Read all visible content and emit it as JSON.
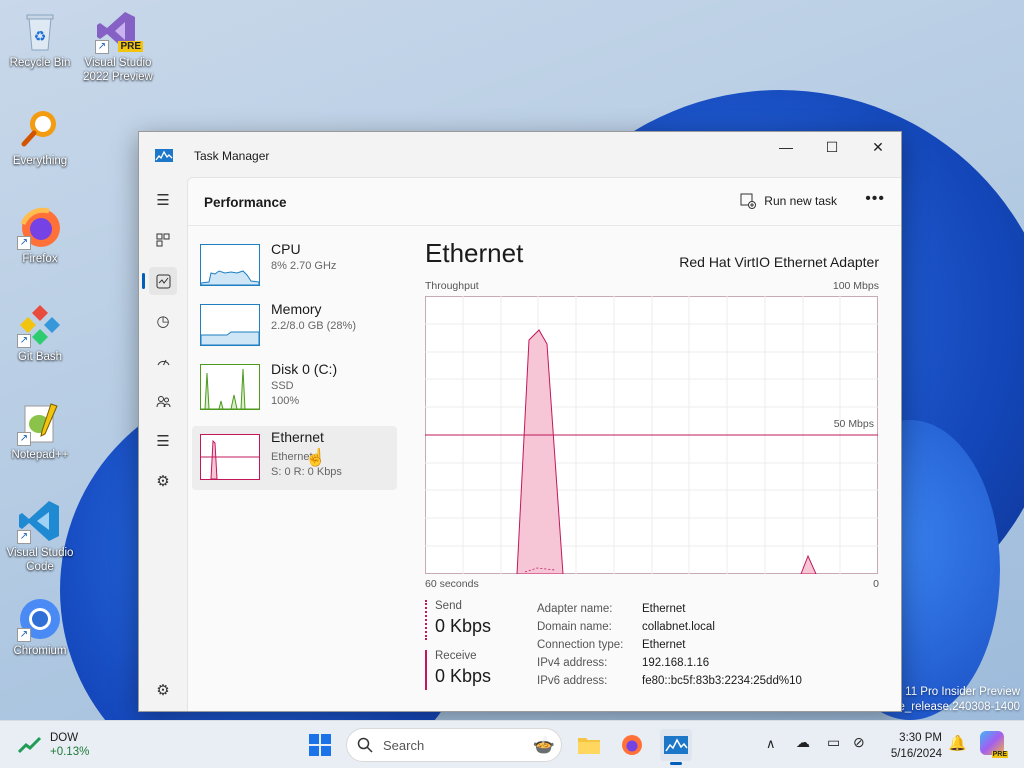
{
  "desktop": {
    "icons": [
      {
        "label": "Recycle Bin",
        "icon": "recycle-bin-icon"
      },
      {
        "label": "Visual Studio 2022 Preview",
        "icon": "visual-studio-preview-icon",
        "badge": "PRE"
      },
      {
        "label": "Everything",
        "icon": "everything-search-icon"
      },
      {
        "label": "Firefox",
        "icon": "firefox-icon"
      },
      {
        "label": "Git Bash",
        "icon": "git-bash-icon"
      },
      {
        "label": "Notepad++",
        "icon": "notepad-plus-plus-icon"
      },
      {
        "label": "Visual Studio Code",
        "icon": "vscode-icon"
      },
      {
        "label": "Chromium",
        "icon": "chromium-icon"
      }
    ],
    "watermark_line1": "11 Pro Insider Preview",
    "watermark_line2": "e_release.240308-1400"
  },
  "window": {
    "title": "Task Manager",
    "page_title": "Performance",
    "run_new_task": "Run new task",
    "more": "•••"
  },
  "perf_list": [
    {
      "name": "CPU",
      "sub1": "8%  2.70 GHz",
      "sub2": ""
    },
    {
      "name": "Memory",
      "sub1": "2.2/8.0 GB (28%)",
      "sub2": ""
    },
    {
      "name": "Disk 0 (C:)",
      "sub1": "SSD",
      "sub2": "100%"
    },
    {
      "name": "Ethernet",
      "sub1": "Ethernet",
      "sub2": "S: 0  R: 0 Kbps"
    }
  ],
  "detail": {
    "title": "Ethernet",
    "adapter": "Red Hat VirtIO Ethernet Adapter",
    "graph_label": "Throughput",
    "graph_max": "100 Mbps",
    "graph_mid": "50 Mbps",
    "graph_time": "60 seconds",
    "graph_zero": "0",
    "send_label": "Send",
    "send_value": "0 Kbps",
    "receive_label": "Receive",
    "receive_value": "0 Kbps",
    "properties": [
      {
        "k": "Adapter name:",
        "v": "Ethernet"
      },
      {
        "k": "Domain name:",
        "v": "collabnet.local"
      },
      {
        "k": "Connection type:",
        "v": "Ethernet"
      },
      {
        "k": "IPv4 address:",
        "v": "192.168.1.16"
      },
      {
        "k": "IPv6 address:",
        "v": "fe80::bc5f:83b3:2234:25dd%10"
      }
    ]
  },
  "taskbar": {
    "stock_name": "DOW",
    "stock_change": "+0.13%",
    "search_placeholder": "Search",
    "time": "3:30 PM",
    "date": "5/16/2024"
  },
  "colors": {
    "accent": "#005fb8",
    "ethernet": "#c2185b",
    "cpu": "#1f7fc1",
    "disk": "#4d9a1f"
  }
}
